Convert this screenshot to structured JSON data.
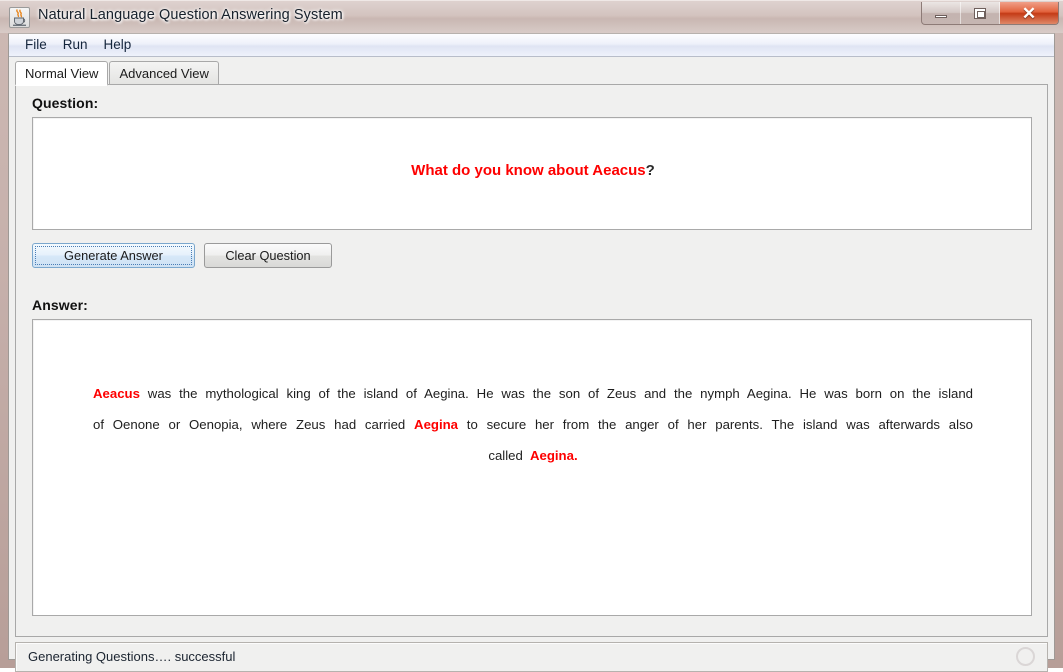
{
  "window": {
    "title": "Natural Language Question Answering System",
    "app_icon": "java-coffee-cup-icon",
    "buttons": {
      "minimize": "minimize-button",
      "maximize": "maximize-button",
      "close": "close-button",
      "close_glyph": "✕"
    }
  },
  "menubar": {
    "items": [
      {
        "label": "File"
      },
      {
        "label": "Run"
      },
      {
        "label": "Help"
      }
    ]
  },
  "tabs": [
    {
      "label": "Normal View",
      "selected": true
    },
    {
      "label": "Advanced View",
      "selected": false
    }
  ],
  "question_section": {
    "label": "Question:",
    "text": "What do you know about Aeacus",
    "question_mark": "?",
    "text_color": "#fe0000",
    "mark_color": "#2a2a2a"
  },
  "buttons": {
    "generate": "Generate Answer",
    "clear": "Clear Question"
  },
  "answer_section": {
    "label": "Answer:",
    "highlight_color": "#fe0000",
    "segments": [
      {
        "text": "Aeacus",
        "highlight": true
      },
      {
        "text": " was the mythological king of the island of Aegina. He was the son of Zeus and the nymph Aegina.  He was born on the island of Oenone or Oenopia, where Zeus had carried ",
        "highlight": false
      },
      {
        "text": "Aegina",
        "highlight": true
      },
      {
        "text": " to secure her from the anger of her parents. The island was afterwards also called ",
        "highlight": false
      },
      {
        "text": "Aegina.",
        "highlight": true
      }
    ]
  },
  "statusbar": {
    "text": "Generating Questions…. successful",
    "resize_grip": "resize-ring-icon"
  }
}
